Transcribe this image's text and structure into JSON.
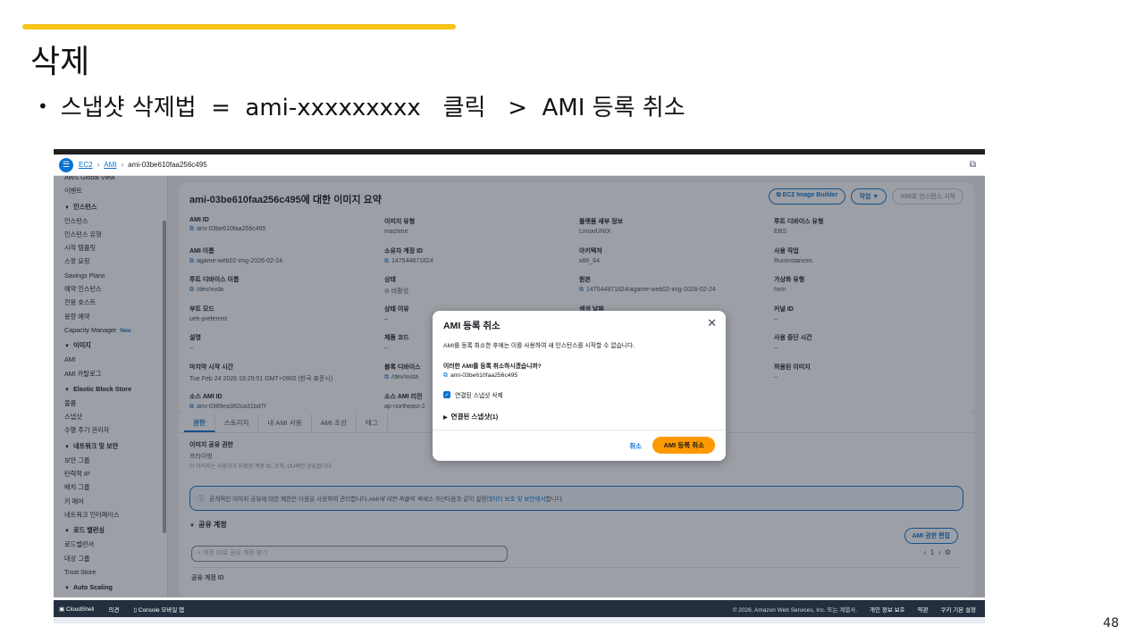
{
  "slide": {
    "title": "삭제",
    "bullet": "스냅샷 삭제법  =  ami-xxxxxxxxx   클릭   >  AMI 등록 취소",
    "page_number": "48"
  },
  "topnav": {
    "breadcrumb": [
      "EC2",
      "AMI",
      "ami-03be610faa256c495"
    ]
  },
  "sidebar": {
    "top_items": [
      "AWS Global View",
      "이벤트"
    ],
    "sections": [
      {
        "title": "인스턴스",
        "items": [
          "인스턴스",
          "인스턴스 유형",
          "시작 템플릿",
          "스팟 요청",
          "Savings Plans",
          "예약 인스턴스",
          "전용 호스트",
          "용량 예약",
          "Capacity Manager"
        ]
      },
      {
        "title": "이미지",
        "items": [
          "AMI",
          "AMI 카탈로그"
        ]
      },
      {
        "title": "Elastic Block Store",
        "items": [
          "볼륨",
          "스냅샷",
          "수명 주기 관리자"
        ]
      },
      {
        "title": "네트워크 및 보안",
        "items": [
          "보안 그룹",
          "탄력적 IP",
          "배치 그룹",
          "키 페어",
          "네트워크 인터페이스"
        ]
      },
      {
        "title": "로드 밸런싱",
        "items": [
          "로드밸런서",
          "대상 그룹",
          "Trust Store"
        ]
      },
      {
        "title": "Auto Scaling",
        "items": []
      }
    ],
    "new_badge": "New"
  },
  "summary": {
    "title": "ami-03be610faa256c495에 대한 이미지 요약",
    "btn_image_builder": "EC2 Image Builder",
    "btn_actions": "작업 ▼",
    "btn_launch": "AMI로 인스턴스 시작",
    "fields": [
      {
        "label": "AMI ID",
        "value": "ami-03be610faa256c495",
        "copy": true
      },
      {
        "label": "이미지 유형",
        "value": "machine",
        "copy": false
      },
      {
        "label": "플랫폼 세부 정보",
        "value": "Linux/UNIX",
        "copy": false
      },
      {
        "label": "루트 디바이스 유형",
        "value": "EBS",
        "copy": false
      },
      {
        "label": "AMI 이름",
        "value": "agame-web02-img-2026-02-24",
        "copy": true
      },
      {
        "label": "소유자 계정 ID",
        "value": "147544871824",
        "copy": true
      },
      {
        "label": "아키텍처",
        "value": "x86_64",
        "copy": false
      },
      {
        "label": "사용 작업",
        "value": "RunInstances",
        "copy": false
      },
      {
        "label": "루트 디바이스 이름",
        "value": "/dev/xvda",
        "copy": true
      },
      {
        "label": "상태",
        "value": "⊝ 비활성",
        "copy": false
      },
      {
        "label": "원본",
        "value": "147544871824/agame-web02-img-2026-02-24",
        "copy": true
      },
      {
        "label": "가상화 유형",
        "value": "hvm",
        "copy": false
      },
      {
        "label": "부트 모드",
        "value": "uefi-preferred",
        "copy": false
      },
      {
        "label": "상태 이유",
        "value": "–",
        "copy": false
      },
      {
        "label": "생성 날짜",
        "value": "2026-02-24T08:53:26.000Z",
        "copy": true
      },
      {
        "label": "커널 ID",
        "value": "–",
        "copy": false
      },
      {
        "label": "설명",
        "value": "–",
        "copy": false
      },
      {
        "label": "제품 코드",
        "value": "–",
        "copy": false
      },
      {
        "label": "",
        "value": "",
        "copy": false
      },
      {
        "label": "사용 중단 시간",
        "value": "–",
        "copy": false
      },
      {
        "label": "마지막 시작 시간",
        "value": "Tue Feb 24 2026 19:29:51 GMT+0900 (한국 표준시)",
        "copy": false
      },
      {
        "label": "블록 디바이스",
        "value": "/dev/xvda",
        "copy": true
      },
      {
        "label": "",
        "value": "",
        "copy": false
      },
      {
        "label": "허용된 이미지",
        "value": "–",
        "copy": false
      },
      {
        "label": "소스 AMI ID",
        "value": "ami-0389ea382ca31bd7f",
        "copy": true
      },
      {
        "label": "소스 AMI 리전",
        "value": "ap-northeast-2",
        "copy": false
      },
      {
        "label": "",
        "value": "",
        "copy": false
      },
      {
        "label": "",
        "value": "",
        "copy": false
      }
    ]
  },
  "tabs": [
    "권한",
    "스토리지",
    "내 AMI 사용",
    "AMI 조상",
    "태그"
  ],
  "permissions": {
    "label": "이미지 공유 권한",
    "value": "프라이빗",
    "hint": "이 이미지는 사용자가 지정한 계정 ID, 조직, OU에만 공유됩니다.",
    "info_text": "공개적인 이미지 공유에 대한 제한은 다음을 사용하여 관리합니다.",
    "info_italic": "AMI에 대한 퍼블릭 액세스 차단",
    "info_mid": " 다음과 같이 설정 ",
    "info_link": "데이터 보호 및 보안에서",
    "info_end": " 합니다.",
    "shared_header": "공유 계정",
    "edit_button": "AMI 권한 편집",
    "search_placeholder": "계정 ID로 공유 계정 찾기",
    "page": "1",
    "column": "공유 계정 ID"
  },
  "modal": {
    "title": "AMI 등록 취소",
    "description": "AMI를 등록 취소한 후에는 이를 사용하여 새 인스턴스를 시작할 수 없습니다.",
    "question": "이러한 AMI를 등록 취소하시겠습니까?",
    "ami_id": "ami-03be610faa256c495",
    "checkbox_label": "연결된 스냅샷 삭제",
    "expand_label": "연결된 스냅샷(1)",
    "cancel": "취소",
    "confirm": "AMI 등록 취소"
  },
  "footer": {
    "cloudshell": "CloudShell",
    "feedback": "의견",
    "console_app": "Console 모바일 앱",
    "copyright": "© 2026, Amazon Web Services, Inc. 또는 계열사.",
    "privacy": "개인 정보 보호",
    "terms": "약관",
    "cookies": "쿠키 기본 설정"
  }
}
